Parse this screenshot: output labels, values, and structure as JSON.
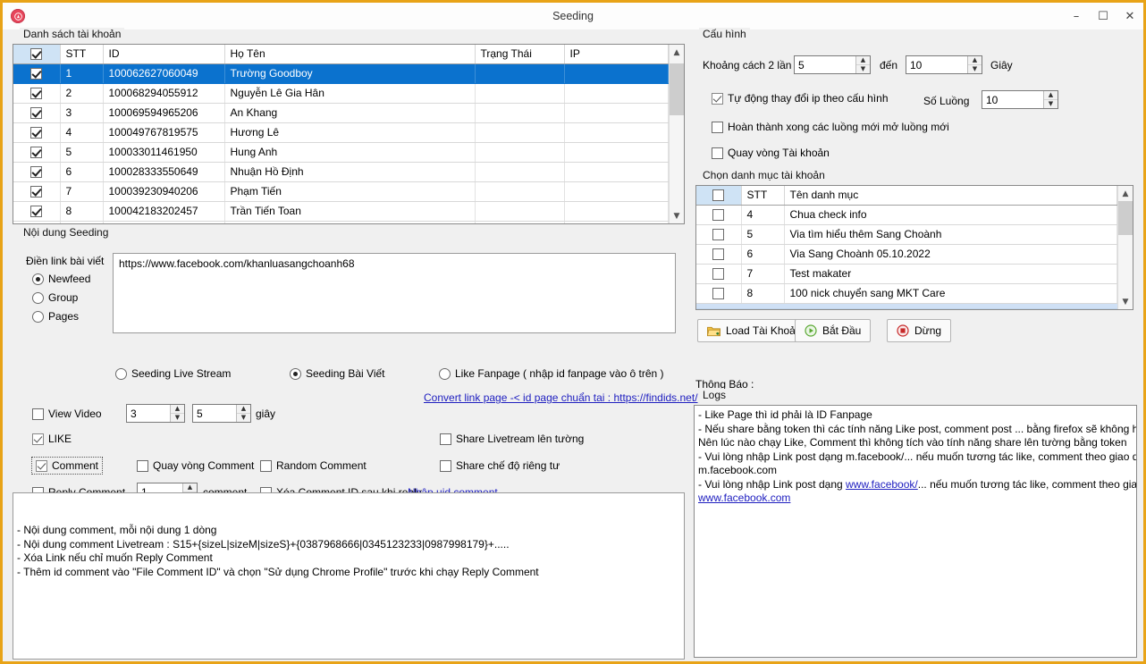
{
  "window": {
    "title": "Seeding",
    "app_icon": "app-logo-icon",
    "minimize": "–",
    "maximize": "☐",
    "close": "✕"
  },
  "accounts_panel": {
    "title": "Danh sách tài khoản",
    "columns": [
      "",
      "STT",
      "ID",
      "Họ Tên",
      "Trạng Thái",
      "IP"
    ],
    "rows": [
      {
        "checked": true,
        "stt": "1",
        "id": "100062627060049",
        "name": "Trường Goodboy",
        "status": "",
        "ip": "",
        "selected": true
      },
      {
        "checked": true,
        "stt": "2",
        "id": "100068294055912",
        "name": "Nguyễn Lê Gia Hân",
        "status": "",
        "ip": "",
        "selected": false
      },
      {
        "checked": true,
        "stt": "3",
        "id": "100069594965206",
        "name": "An Khang",
        "status": "",
        "ip": "",
        "selected": false
      },
      {
        "checked": true,
        "stt": "4",
        "id": "100049767819575",
        "name": "Hương Lê",
        "status": "",
        "ip": "",
        "selected": false
      },
      {
        "checked": true,
        "stt": "5",
        "id": "100033011461950",
        "name": "Hung Anh",
        "status": "",
        "ip": "",
        "selected": false
      },
      {
        "checked": true,
        "stt": "6",
        "id": "100028333550649",
        "name": "Nhuận Hồ Định",
        "status": "",
        "ip": "",
        "selected": false
      },
      {
        "checked": true,
        "stt": "7",
        "id": "100039230940206",
        "name": "Phạm Tiến",
        "status": "",
        "ip": "",
        "selected": false
      },
      {
        "checked": true,
        "stt": "8",
        "id": "100042183202457",
        "name": "Trần Tiến Toan",
        "status": "",
        "ip": "",
        "selected": false
      }
    ],
    "header_checkbox_checked": true
  },
  "seeding_panel": {
    "title": "Nội dung Seeding",
    "link_label": "Điền link bài viết",
    "link_value": "https://www.facebook.com/khanluasangchoanh68",
    "targets": [
      {
        "label": "Newfeed",
        "selected": true
      },
      {
        "label": "Group",
        "selected": false
      },
      {
        "label": "Pages",
        "selected": false
      }
    ],
    "modes": [
      {
        "label": "Seeding Live Stream",
        "selected": false
      },
      {
        "label": "Seeding Bài Viết",
        "selected": true
      },
      {
        "label": "Like Fanpage ( nhập id fanpage vào ô trên )",
        "selected": false
      }
    ],
    "convert_link": "Convert link page -< id page chuẩn tai : https://findids.net/",
    "view_video": {
      "label": "View Video",
      "checked": false,
      "from": "3",
      "to": "5",
      "unit": "giây"
    },
    "like": {
      "label": "LIKE",
      "checked": true
    },
    "comment": {
      "label": "Comment",
      "checked": true
    },
    "quay_vong_comment": {
      "label": "Quay vòng Comment",
      "checked": false
    },
    "random_comment": {
      "label": "Random Comment",
      "checked": false
    },
    "reply_comment": {
      "label": "Reply Comment",
      "checked": false,
      "count": "1",
      "unit": "comment"
    },
    "xoa_comment_id": {
      "label": "Xóa Comment ID sau khi reply",
      "checked": false
    },
    "nhap_uid_comment": "Nhập uid comment",
    "share_livestream": {
      "label": "Share Livetream lên tường",
      "checked": false
    },
    "share_rieng_tu": {
      "label": "Share chế độ riêng tư",
      "checked": false
    }
  },
  "comment_box": {
    "lines": [
      "- Nội dung comment, mỗi nội dung 1 dòng",
      "- Nội dung comment Livetream : S15+{sizeL|sizeM|sizeS}+{0387968666|0345123233|0987998179}+.....",
      "- Xóa Link nếu chỉ muốn Reply Comment",
      "- Thêm id comment vào \"File Comment ID\" và chọn \"Sử dụng Chrome Profile\" trước khi chạy Reply Comment"
    ]
  },
  "config_panel": {
    "title": "Cấu hình",
    "interval_label": "Khoảng cách 2 lần",
    "interval_from": "5",
    "den_label": "đến",
    "interval_to": "10",
    "seconds_label": "Giây",
    "auto_ip": {
      "label": "Tự động thay đổi ip theo cấu hình",
      "checked": true
    },
    "threads_label": "Số Luồng",
    "threads_value": "10",
    "finish_threads": {
      "label": "Hoàn thành xong các luồng mới mở luồng mới",
      "checked": false
    },
    "rotate_accounts": {
      "label": "Quay vòng Tài khoản",
      "checked": false
    }
  },
  "category_panel": {
    "title": "Chọn danh mục tài khoản",
    "columns": [
      "",
      "STT",
      "Tên danh mục"
    ],
    "rows": [
      {
        "checked": false,
        "stt": "4",
        "name": "Chua check info"
      },
      {
        "checked": false,
        "stt": "5",
        "name": "Via tìm hiểu thêm Sang Choành"
      },
      {
        "checked": false,
        "stt": "6",
        "name": "Via Sang Choành 05.10.2022"
      },
      {
        "checked": false,
        "stt": "7",
        "name": "Test makater"
      },
      {
        "checked": false,
        "stt": "8",
        "name": "100 nick chuyển sang MKT Care"
      }
    ]
  },
  "actions": {
    "load_accounts": "Load Tài Khoản",
    "start": "Bắt Đầu",
    "stop": "Dừng",
    "load_icon": "folder-icon",
    "start_icon": "play-circle-icon",
    "stop_icon": "stop-circle-icon"
  },
  "notice": {
    "label": "Thông Báo :"
  },
  "logs": {
    "title": "Logs",
    "lines": [
      "- Like Page thì id phải là ID Fanpage",
      "- Nếu share bằng token thì các tính năng Like post, comment post ... bằng firefox sẽ không hoạt động.",
      "Nên lúc nào chạy Like, Comment thì không tích vào tính năng share lên tường bằng token",
      "- Vui lòng nhập Link post dạng m.facebook/... nếu muốn tương tác like, comment theo giao diện",
      "m.facebook.com"
    ],
    "link_line_prefix": "- Vui lòng nhập Link post dạng ",
    "link_line_link": "www.facebook/",
    "link_line_suffix": "... nếu muốn tương tác like, comment theo giao diện",
    "link_last": "www.facebook.com"
  },
  "colors": {
    "window_border": "#e8a317",
    "selection": "#0b72ce",
    "header_checkbox_bg": "#cfe3f5",
    "link": "#2020c0"
  }
}
